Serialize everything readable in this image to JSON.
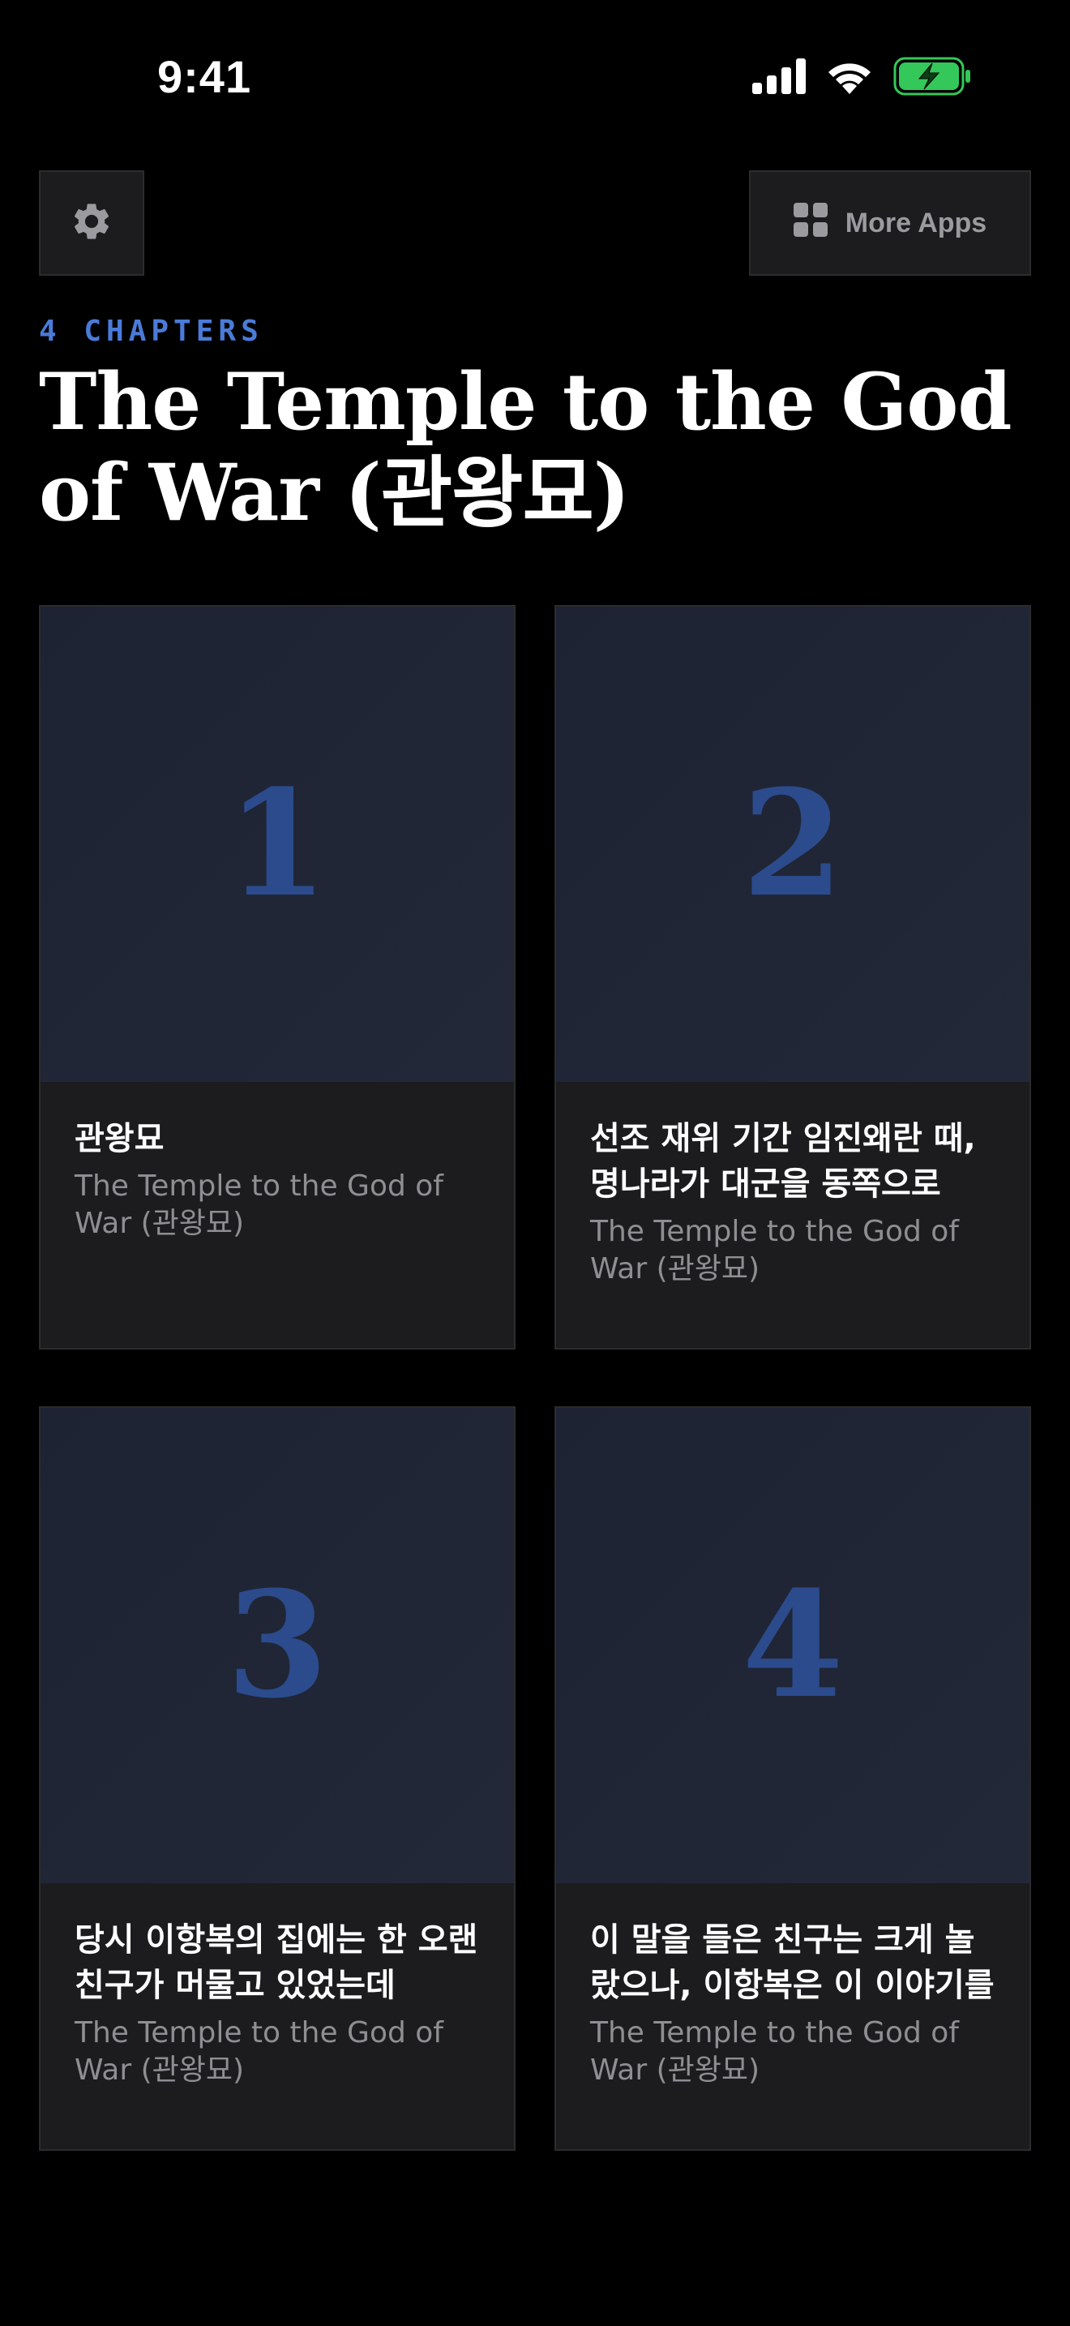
{
  "status_bar": {
    "time": "9:41",
    "icons": [
      "cellular-signal-icon",
      "wifi-icon",
      "battery-charging-icon"
    ],
    "battery_color": "#34c759"
  },
  "toolbar": {
    "settings_icon": "gear-icon",
    "more_apps_icon": "grid-icon",
    "more_apps_label": "More Apps"
  },
  "header": {
    "chapter_count": "4 CHAPTERS",
    "title": "The Temple to the God of War (관왕묘)"
  },
  "colors": {
    "accent": "#4a7bd8",
    "cover_number": "#2b4b8c",
    "card_background": "#1c1c1e",
    "background": "#000000"
  },
  "chapters": [
    {
      "number": "1",
      "title": "관왕묘",
      "subtitle": "The Temple to the God of War (관왕묘)"
    },
    {
      "number": "2",
      "title": "선조 재위 기간 임진왜란 때, 명나라가 대군을 동쪽으로",
      "subtitle": "The Temple to the God of War (관왕묘)"
    },
    {
      "number": "3",
      "title": "당시 이항복의 집에는 한 오랜 친구가 머물고 있었는데",
      "subtitle": "The Temple to the God of War (관왕묘)"
    },
    {
      "number": "4",
      "title": "이 말을 들은 친구는 크게 놀랐으나, 이항복은 이 이야기를",
      "subtitle": "The Temple to the God of War (관왕묘)"
    }
  ]
}
